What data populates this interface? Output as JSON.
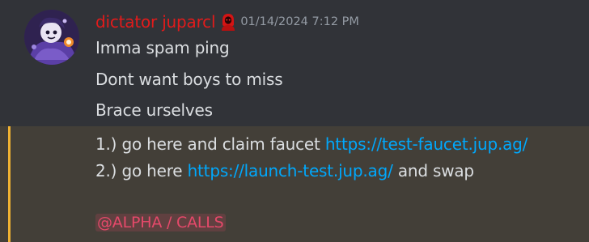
{
  "message": {
    "username": "dictator juparcl",
    "timestamp": "01/14/2024 7:12 PM",
    "avatar_icon": "avatar-character-icon",
    "role_icon": "red-hooded-figure-icon",
    "lines": [
      "Imma spam ping",
      "Dont want boys to miss",
      "Brace urselves"
    ],
    "steps": {
      "step1_text": "1.) go here and claim faucet ",
      "step1_link": "https://test-faucet.jup.ag/",
      "step2_text": "2.) go here ",
      "step2_link": "https://launch-test.jup.ag/",
      "step2_suffix": " and swap"
    },
    "mention": "@ALPHA / CALLS"
  },
  "colors": {
    "background": "#313338",
    "username": "#e21b1b",
    "link": "#00a8fc",
    "mention_highlight_bg": "#433f38",
    "mention_bar": "#f0b232",
    "mention_text": "#e5496a"
  }
}
